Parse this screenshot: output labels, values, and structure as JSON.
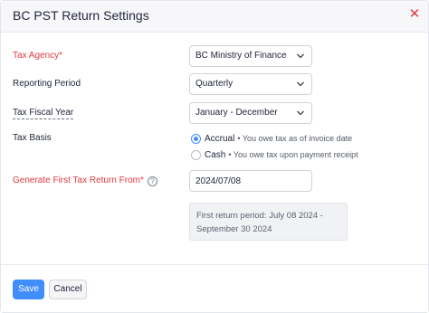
{
  "dialog": {
    "title": "BC PST Return Settings",
    "close_glyph": "✕"
  },
  "form": {
    "tax_agency": {
      "label": "Tax Agency*",
      "value": "BC Ministry of Finance"
    },
    "reporting_period": {
      "label": "Reporting Period",
      "value": "Quarterly"
    },
    "tax_fiscal_year": {
      "label": "Tax Fiscal Year",
      "value": "January - December"
    },
    "tax_basis": {
      "label": "Tax Basis",
      "options": [
        {
          "label": "Accrual",
          "description": "• You owe tax as of invoice date",
          "selected": true
        },
        {
          "label": "Cash",
          "description": "• You owe tax upon payment receipt",
          "selected": false
        }
      ]
    },
    "first_return": {
      "label": "Generate First Tax Return From*",
      "help_glyph": "?",
      "value": "2024/07/08",
      "info_line1": "First return period: July 08 2024 -",
      "info_line2": "September 30 2024"
    }
  },
  "footer": {
    "save_label": "Save",
    "cancel_label": "Cancel"
  },
  "colors": {
    "accent": "#408dfb",
    "required": "#e0393e"
  }
}
